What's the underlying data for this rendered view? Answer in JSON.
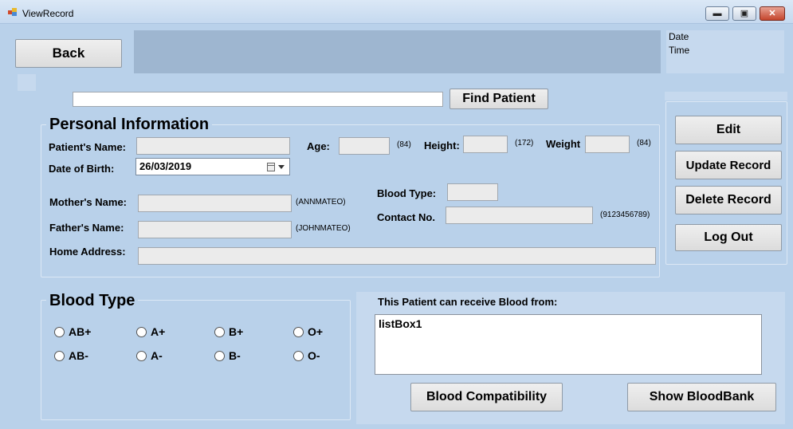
{
  "window": {
    "title": "ViewRecord",
    "min_label": "▬",
    "max_label": "▣",
    "close_label": "✕"
  },
  "toolbar": {
    "back": "Back",
    "find": "Find Patient",
    "search_value": ""
  },
  "datetime": {
    "date": "Date",
    "time": "Time"
  },
  "actions": {
    "edit": "Edit",
    "update": "Update Record",
    "delete": "Delete Record",
    "logout": "Log Out"
  },
  "personal": {
    "heading": "Personal Information",
    "name_label": "Patient's Name:",
    "name_value": "",
    "dob_label": "Date of Birth:",
    "dob_value": "26/03/2019",
    "age_label": "Age:",
    "age_value": "",
    "age_hint": "(84)",
    "height_label": "Height:",
    "height_value": "",
    "height_hint": "(172)",
    "weight_label": "Weight",
    "weight_value": "",
    "weight_hint": "(84)",
    "mother_label": "Mother's Name:",
    "mother_value": "",
    "mother_hint": "(ANNMATEO)",
    "father_label": "Father's Name:",
    "father_value": "",
    "father_hint": "(JOHNMATEO)",
    "blood_label": "Blood Type:",
    "blood_value": "",
    "contact_label": "Contact No.",
    "contact_value": "",
    "contact_hint": "(9123456789)",
    "address_label": "Home Address:",
    "address_value": ""
  },
  "blood": {
    "heading": "Blood Type",
    "options": [
      "AB+",
      "A+",
      "B+",
      "O+",
      "AB-",
      "A-",
      "B-",
      "O-"
    ]
  },
  "receive": {
    "label": "This Patient can receive Blood from:",
    "listbox": "listBox1",
    "compat": "Blood Compatibility",
    "bank": "Show BloodBank"
  }
}
